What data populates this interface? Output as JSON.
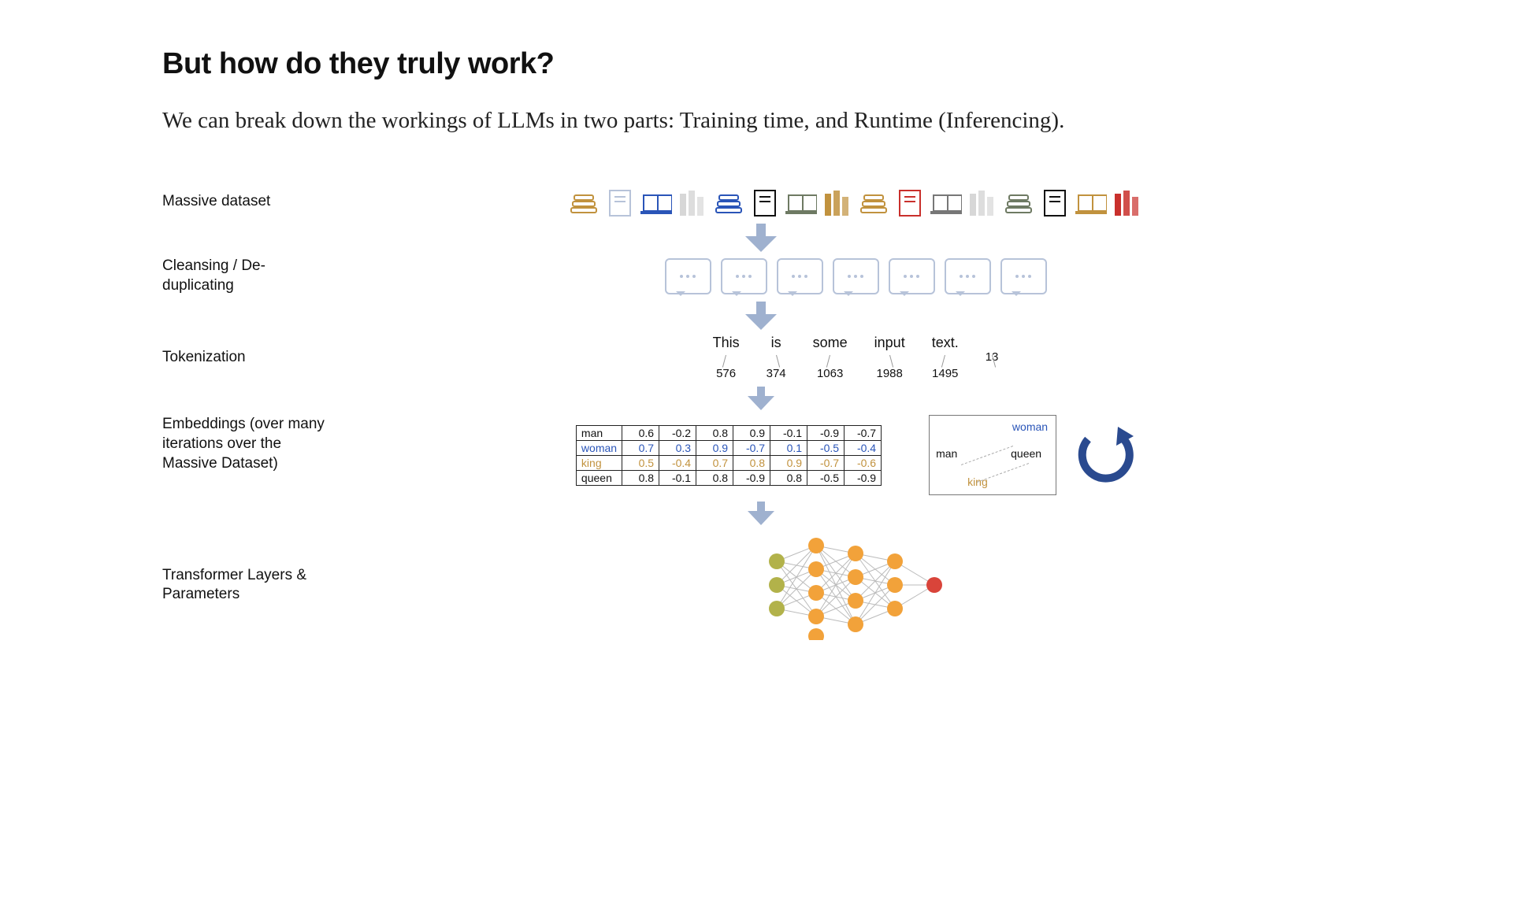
{
  "heading": "But how do they truly work?",
  "intro": "We can break down the workings of LLMs in two parts: Training time, and Runtime (Inferencing).",
  "stages": {
    "dataset": "Massive dataset",
    "cleanse": "Cleansing / De-duplicating",
    "token": "Tokenization",
    "embed": "Embeddings (over many iterations over the Massive Dataset)",
    "transformer": "Transformer Layers & Parameters"
  },
  "tokenization": {
    "tokens": [
      "This",
      "is",
      "some",
      "input",
      "text.",
      ""
    ],
    "ids": [
      "576",
      "374",
      "1063",
      "1988",
      "1495",
      "13"
    ]
  },
  "embeddings": {
    "rows": [
      {
        "label": "man",
        "vals": [
          "0.6",
          "-0.2",
          "0.8",
          "0.9",
          "-0.1",
          "-0.9",
          "-0.7"
        ],
        "cls": ""
      },
      {
        "label": "woman",
        "vals": [
          "0.7",
          "0.3",
          "0.9",
          "-0.7",
          "0.1",
          "-0.5",
          "-0.4"
        ],
        "cls": "row-woman"
      },
      {
        "label": "king",
        "vals": [
          "0.5",
          "-0.4",
          "0.7",
          "0.8",
          "0.9",
          "-0.7",
          "-0.6"
        ],
        "cls": "row-king"
      },
      {
        "label": "queen",
        "vals": [
          "0.8",
          "-0.1",
          "0.8",
          "-0.9",
          "0.8",
          "-0.5",
          "-0.9"
        ],
        "cls": ""
      }
    ]
  },
  "embed_space": {
    "man": "man",
    "woman": "woman",
    "king": "king",
    "queen": "queen"
  },
  "icon_colors": [
    "#c1923e",
    "#b7c3d9",
    "#2a55b8",
    "#d7d7d7",
    "#2a55b8",
    "#111",
    "#6e7a63",
    "#c1923e",
    "#c1923e",
    "#c9302c",
    "#777",
    "#d7d7d7",
    "#6e7a63",
    "#111",
    "#c1923e",
    "#c9302c"
  ]
}
